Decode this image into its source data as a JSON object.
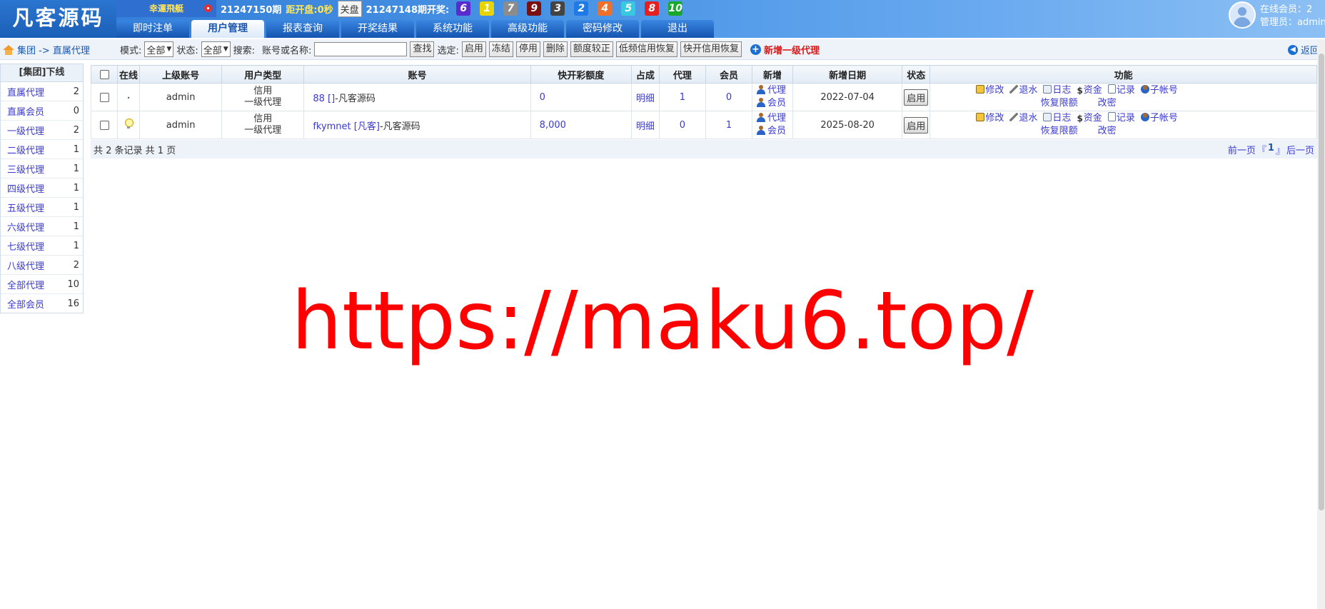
{
  "header": {
    "logo": "凡客源码",
    "lottery_name": "幸運飛艇",
    "current_period": "21247150期",
    "countdown_label": "距开盘:",
    "countdown_value": "0秒",
    "close_button": "关盘",
    "last_period_label": "21247148期开奖:",
    "balls": [
      {
        "n": "6",
        "color": "#5a2ccf"
      },
      {
        "n": "1",
        "color": "#e8d400"
      },
      {
        "n": "7",
        "color": "#8c8c8c"
      },
      {
        "n": "9",
        "color": "#7a1010"
      },
      {
        "n": "3",
        "color": "#444444"
      },
      {
        "n": "2",
        "color": "#1f7ae6"
      },
      {
        "n": "4",
        "color": "#f0702a"
      },
      {
        "n": "5",
        "color": "#38c8e0"
      },
      {
        "n": "8",
        "color": "#e42020"
      },
      {
        "n": "10",
        "color": "#1aa82c"
      }
    ],
    "tabs": [
      "即时注单",
      "用户管理",
      "报表查询",
      "开奖结果",
      "系统功能",
      "高级功能",
      "密码修改",
      "退出"
    ],
    "active_tab": 1,
    "online_members": "在线会员：2",
    "admin": "管理员：admin"
  },
  "toolbar": {
    "breadcrumb": "集团 -> 直属代理",
    "mode_label": "模式:",
    "mode_value": "全部",
    "status_label": "状态:",
    "status_value": "全部",
    "search_label": "搜索:",
    "account_label": "账号或名称:",
    "search_value": "",
    "search_button": "查找",
    "select_label": "选定:",
    "actions": [
      "启用",
      "冻结",
      "停用",
      "删除",
      "额度较正",
      "低频信用恢复",
      "快开信用恢复"
    ],
    "add_agent": "新增一级代理",
    "back": "返回"
  },
  "sidebar": {
    "title": "[集团]下线",
    "items": [
      {
        "label": "直属代理",
        "count": "2"
      },
      {
        "label": "直属会员",
        "count": "0"
      },
      {
        "label": "一级代理",
        "count": "2"
      },
      {
        "label": "二级代理",
        "count": "1"
      },
      {
        "label": "三级代理",
        "count": "1"
      },
      {
        "label": "四级代理",
        "count": "1"
      },
      {
        "label": "五级代理",
        "count": "1"
      },
      {
        "label": "六级代理",
        "count": "1"
      },
      {
        "label": "七级代理",
        "count": "1"
      },
      {
        "label": "八级代理",
        "count": "2"
      },
      {
        "label": "全部代理",
        "count": "10"
      },
      {
        "label": "全部会员",
        "count": "16"
      }
    ]
  },
  "table": {
    "columns": [
      "在线",
      "上级账号",
      "用户类型",
      "账号",
      "快开彩额度",
      "占成",
      "代理",
      "会员",
      "新增",
      "新增日期",
      "状态",
      "功能"
    ],
    "rows": [
      {
        "online": "•",
        "parent": "admin",
        "type_line1": "信用",
        "type_line2": "一级代理",
        "account_id": "88",
        "account_bracket": "[]",
        "account_name": "-凡客源码",
        "quota": "0",
        "share": "明细",
        "agents": "1",
        "members": "0",
        "add_agent": "代理",
        "add_member": "会员",
        "date": "2022-07-04",
        "status": "启用"
      },
      {
        "online": "",
        "parent": "admin",
        "type_line1": "信用",
        "type_line2": "一级代理",
        "account_id": "fkymnet",
        "account_bracket": "[凡客]",
        "account_name": "-凡客源码",
        "quota": "8,000",
        "share": "明细",
        "agents": "0",
        "members": "1",
        "add_agent": "代理",
        "add_member": "会员",
        "date": "2025-08-20",
        "status": "启用"
      }
    ],
    "functions": {
      "edit": "修改",
      "rebate": "退水",
      "log": "日志",
      "money_symbol": "$",
      "funds": "资金",
      "records": "记录",
      "sub_account": "子帐号",
      "restore_limit": "恢复限额",
      "change_password": "改密"
    }
  },
  "footer": {
    "summary": "共 2 条记录 共 1 页",
    "prev": "前一页",
    "bracket_open": "『",
    "current_page": "1",
    "bracket_close": "』",
    "next": "后一页"
  },
  "watermark": "https://maku6.top/"
}
